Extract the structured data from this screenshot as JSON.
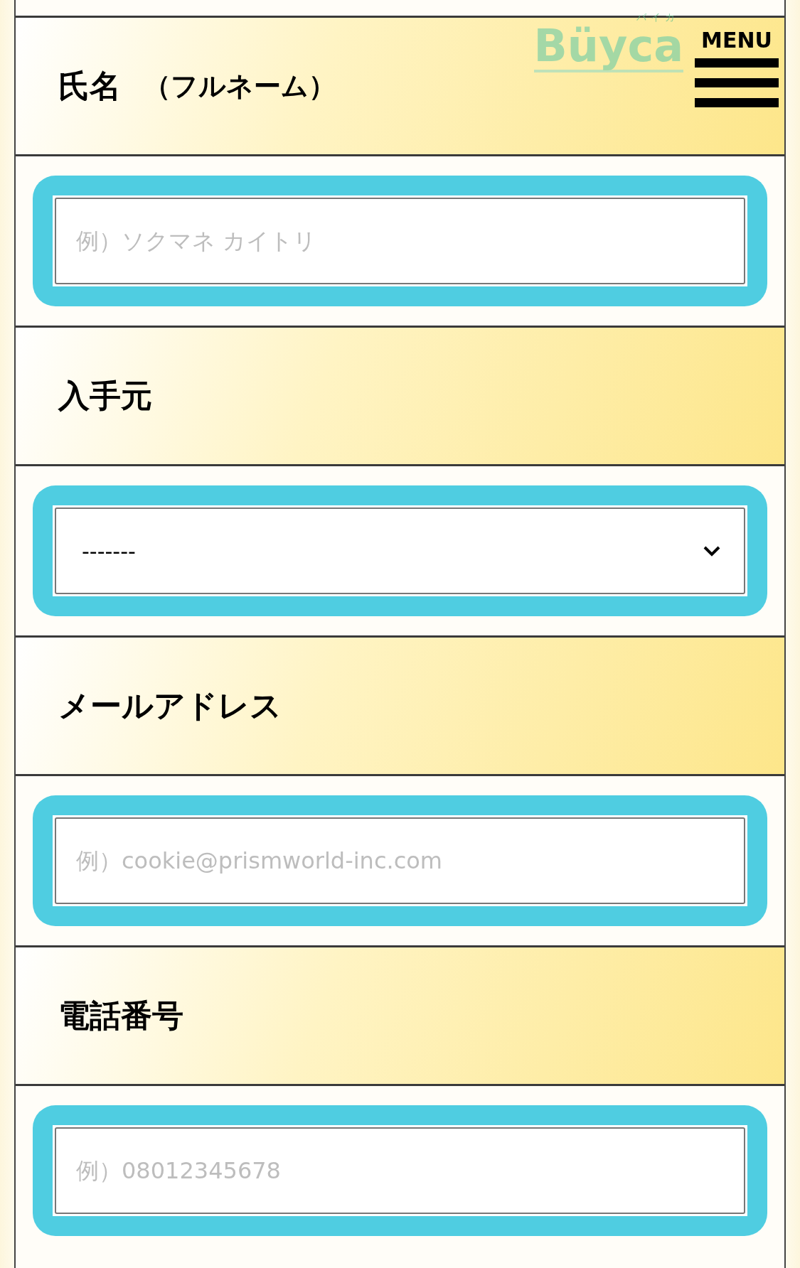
{
  "logo": {
    "text": "Büyca",
    "ruby": "バイカ"
  },
  "menu": {
    "label": "MENU"
  },
  "fields": [
    {
      "label": "氏名",
      "note": "（フルネーム）",
      "kind": "text",
      "placeholder": "例）ソクマネ カイトリ"
    },
    {
      "label": "入手元",
      "kind": "select",
      "value": "-------"
    },
    {
      "label": "メールアドレス",
      "kind": "text",
      "placeholder": "例）cookie@prismworld-inc.com"
    },
    {
      "label": "電話番号",
      "kind": "text",
      "placeholder": "例）08012345678"
    }
  ]
}
